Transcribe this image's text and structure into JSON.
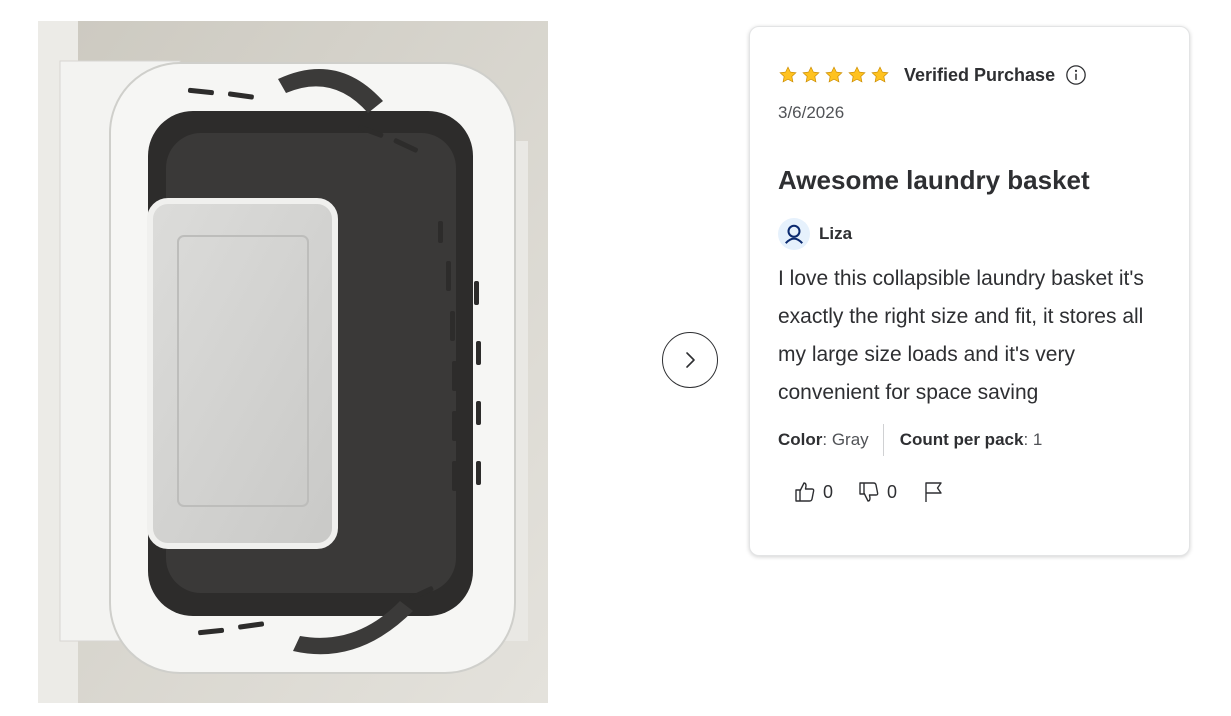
{
  "photo": {
    "alt_icon": "laundry-basket-photo"
  },
  "navigation": {
    "next_icon": "chevron-right-icon"
  },
  "review": {
    "rating": 5,
    "rating_max": 5,
    "star_color": "#ffc220",
    "verified_label": "Verified Purchase",
    "date": "3/6/2026",
    "title": "Awesome laundry basket",
    "author": "Liza",
    "body": "I love this collapsible laundry basket it's exactly the right size and fit, it stores all my large size loads and it's very convenient for space saving",
    "attributes": [
      {
        "label": "Color",
        "value": ": Gray"
      },
      {
        "label": "Count per pack",
        "value": ": 1"
      }
    ],
    "helpful_count": "0",
    "unhelpful_count": "0"
  }
}
